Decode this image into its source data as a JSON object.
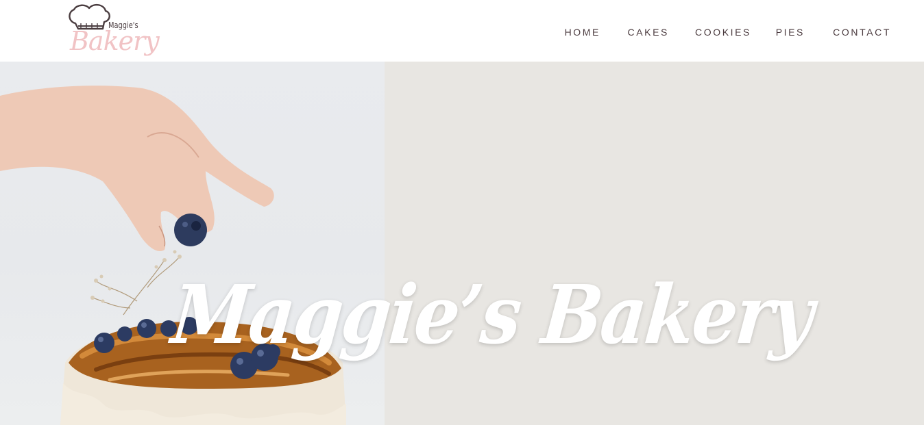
{
  "brand": {
    "logo_small_text": "Maggie's",
    "logo_script_text": "Bakery",
    "logo_icon": "chef-hat-icon"
  },
  "nav": {
    "items": [
      {
        "label": "HOME"
      },
      {
        "label": "CAKES"
      },
      {
        "label": "COOKIES"
      },
      {
        "label": "PIES"
      },
      {
        "label": "CONTACT"
      }
    ]
  },
  "hero": {
    "title": "Maggie’s Bakery",
    "image": "hand-placing-blueberry-on-cake-photo"
  },
  "colors": {
    "nav_text": "#4b3b3f",
    "logo_pink": "#f1c3c5",
    "hero_background": "#e8e6e2",
    "title_text": "#ffffff"
  }
}
